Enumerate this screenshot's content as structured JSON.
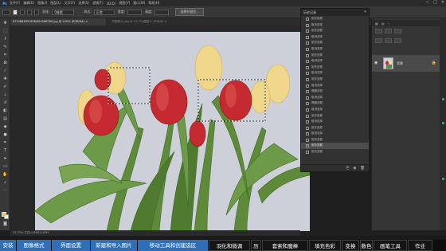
{
  "menubar": {
    "logo": "Ps",
    "items": [
      "文件(F)",
      "编辑(E)",
      "图像(I)",
      "图层(L)",
      "文字(Y)",
      "选择(S)",
      "滤镜(T)",
      "3D(D)",
      "视图(V)",
      "窗口(W)",
      "帮助(H)"
    ],
    "window_controls": [
      "—",
      "□",
      "✕"
    ]
  },
  "options": {
    "feather_label": "羽化:",
    "feather_value": "0像素",
    "style_label": "样式:",
    "style_value": "正常",
    "width_label": "宽度:",
    "height_label": "高度:",
    "select_mask_button": "选择并遮住..."
  },
  "tabs": [
    {
      "label": "872468489180640b3df8780.jpg @ 100% (RGB/8#) ×",
      "state": "active"
    },
    {
      "label": "下载源(1).jpg @ 41.7%(图层 0, RGB/8) ×",
      "state": "inactive"
    }
  ],
  "document": {
    "status": "33.33%    文档:4.69M/4.69M"
  },
  "history": {
    "title": "历史记录",
    "close": "«",
    "items": [
      {
        "label": "矩形选框",
        "current": false
      },
      {
        "label": "取消选择",
        "current": false
      },
      {
        "label": "矩形选框",
        "current": false
      },
      {
        "label": "取消选择",
        "current": false
      },
      {
        "label": "矩形选框",
        "current": false
      },
      {
        "label": "取消选择",
        "current": false
      },
      {
        "label": "矩形选框",
        "current": false
      },
      {
        "label": "取消选择",
        "current": false
      },
      {
        "label": "矩形选框",
        "current": false
      },
      {
        "label": "取消选择",
        "current": false
      },
      {
        "label": "矩形选框",
        "current": false
      },
      {
        "label": "取消选择",
        "current": false
      },
      {
        "label": "椭圆选框",
        "current": false
      },
      {
        "label": "取消选择",
        "current": false
      },
      {
        "label": "椭圆选框",
        "current": false
      },
      {
        "label": "取消选择",
        "current": false
      },
      {
        "label": "矩形选框",
        "current": false
      },
      {
        "label": "取消选择",
        "current": false
      },
      {
        "label": "矩形选框",
        "current": false
      },
      {
        "label": "取消选择",
        "current": false
      },
      {
        "label": "矩形选框",
        "current": false
      },
      {
        "label": "矩形选框",
        "current": true
      },
      {
        "label": "矩形选框",
        "current": false
      }
    ]
  },
  "layers": {
    "name": "背景",
    "lock_icon": "lock-icon"
  },
  "coursebar": {
    "items": [
      {
        "label": "安装",
        "style": "blue",
        "w": 20
      },
      {
        "label": "图像格式",
        "style": "blue",
        "w": 43
      },
      {
        "label": "界面设置",
        "style": "blue",
        "w": 48
      },
      {
        "label": "新建和导入图片",
        "style": "blue",
        "w": 58
      },
      {
        "label": "移动工具和创建选区",
        "style": "blue",
        "w": 88
      },
      {
        "label": "羽化和微调",
        "style": "dark",
        "w": 52
      },
      {
        "label": "历",
        "style": "dark",
        "w": 13
      },
      {
        "label": "套索和魔棒",
        "style": "dark",
        "w": 58
      },
      {
        "label": "填充色彩",
        "style": "dark",
        "w": 40
      },
      {
        "label": "变换",
        "style": "dark",
        "w": 22
      },
      {
        "label": "数色",
        "style": "dark",
        "w": 16
      },
      {
        "label": "画笔工具",
        "style": "dark",
        "w": 42
      },
      {
        "label": "作业",
        "style": "dark",
        "w": 31
      }
    ]
  },
  "colors": {
    "brand_blue": "#2e6fb8",
    "foreground": "#f3c14a",
    "background_swatch": "#ffffff",
    "status_green": "#2ec36a"
  }
}
